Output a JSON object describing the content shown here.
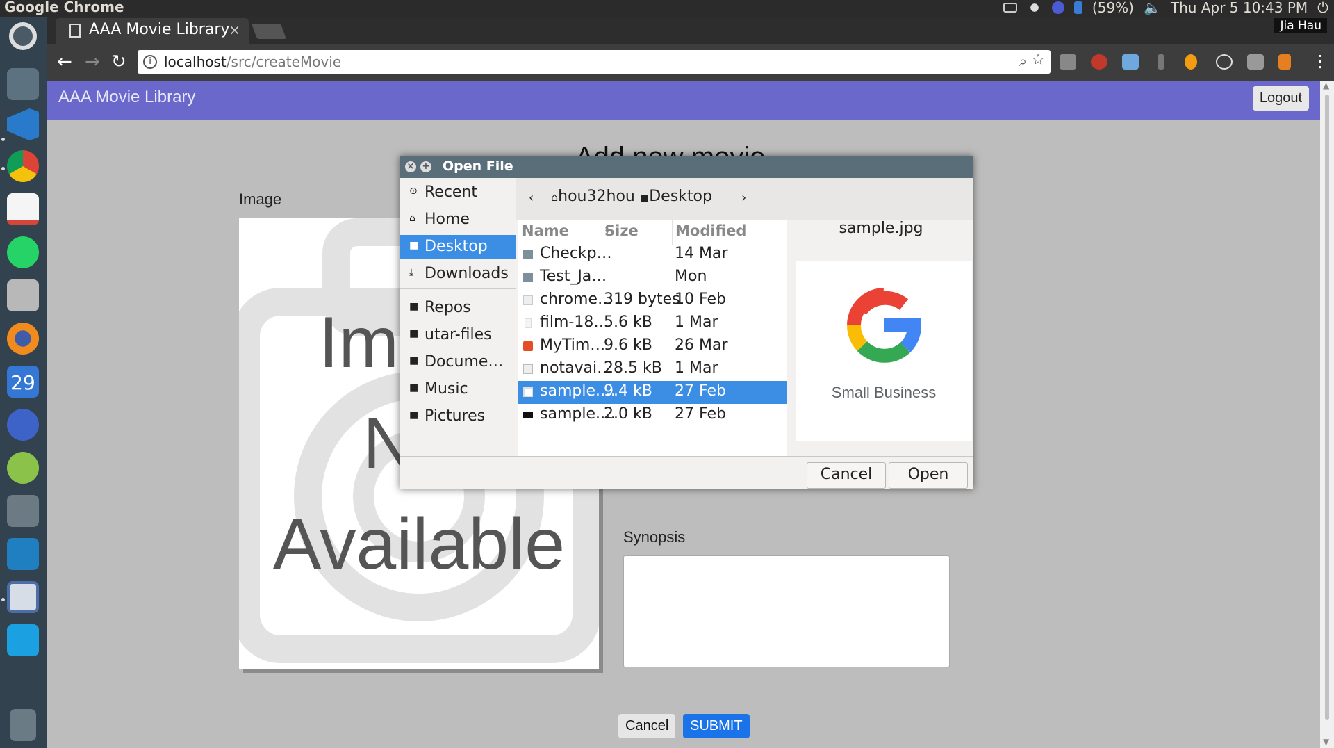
{
  "os_panel": {
    "app_name": "Google Chrome",
    "battery": "(59%)",
    "clock": "Thu Apr  5 10:43 PM"
  },
  "launcher": {
    "items": [
      "ubuntu-dash",
      "settings",
      "vscode",
      "chrome",
      "gmail",
      "whatsapp",
      "files",
      "firefox",
      "calendar",
      "browser",
      "chat",
      "disk-usage",
      "system-monitor",
      "text-editor",
      "workspaces",
      "trash"
    ],
    "calendar_day": "29"
  },
  "browser": {
    "tab_title": "AAA Movie Library",
    "user_name": "Jia Hau",
    "url_host": "localhost",
    "url_path": "/src/createMovie"
  },
  "page": {
    "brand": "AAA Movie Library",
    "logout_label": "Logout",
    "title": "Add new movie",
    "image_label": "Image",
    "image_placeholder_lines": [
      "Image",
      "Not",
      "Available"
    ],
    "synopsis_label": "Synopsis",
    "cancel_label": "Cancel",
    "submit_label": "SUBMIT"
  },
  "dialog": {
    "title": "Open File",
    "places": [
      {
        "label": "Recent",
        "icon": "clock-icon",
        "glyph": "⊙"
      },
      {
        "label": "Home",
        "icon": "home-icon",
        "glyph": "⌂"
      },
      {
        "label": "Desktop",
        "icon": "desktop-icon",
        "glyph": "■"
      },
      {
        "label": "Downloads",
        "icon": "download-icon",
        "glyph": "⤓"
      }
    ],
    "bookmarks": [
      {
        "label": "Repos"
      },
      {
        "label": "utar-files"
      },
      {
        "label": "Docume…"
      },
      {
        "label": "Music"
      },
      {
        "label": "Pictures"
      }
    ],
    "path": {
      "back": "‹",
      "crumbs": [
        "hou32hou",
        "Desktop"
      ],
      "forward": "›"
    },
    "columns": {
      "name": "Name",
      "size": "Size",
      "modified": "Modified"
    },
    "files": [
      {
        "name": "Checkp…",
        "size": "",
        "modified": "14 Mar",
        "type": "folder"
      },
      {
        "name": "Test_Ja…",
        "size": "",
        "modified": "Mon",
        "type": "folder"
      },
      {
        "name": "chrome…",
        "size": "319 bytes",
        "modified": "10 Feb",
        "type": "text"
      },
      {
        "name": "film-18…",
        "size": "5.6 kB",
        "modified": "1 Mar",
        "type": "text"
      },
      {
        "name": "MyTim…",
        "size": "9.6 kB",
        "modified": "26 Mar",
        "type": "html"
      },
      {
        "name": "notavai…",
        "size": "28.5 kB",
        "modified": "1 Mar",
        "type": "image"
      },
      {
        "name": "sample.…",
        "size": "9.4 kB",
        "modified": "27 Feb",
        "type": "image",
        "selected": true
      },
      {
        "name": "sample.…",
        "size": "2.0 kB",
        "modified": "27 Feb",
        "type": "dark"
      }
    ],
    "preview_name": "sample.jpg",
    "preview_caption": "Small Business",
    "cancel_label": "Cancel",
    "open_label": "Open"
  },
  "colors": {
    "navbar": "#6b68cc",
    "selection": "#3c8ee5",
    "submit": "#1a73e8"
  }
}
